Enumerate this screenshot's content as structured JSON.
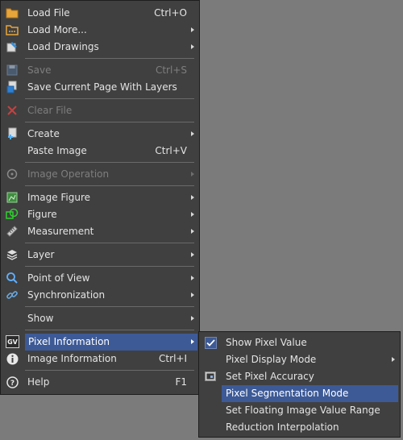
{
  "main_menu": {
    "items": [
      {
        "label": "Load File",
        "shortcut": "Ctrl+O"
      },
      {
        "label": "Load More..."
      },
      {
        "label": "Load Drawings"
      },
      {
        "label": "Save",
        "shortcut": "Ctrl+S"
      },
      {
        "label": "Save Current Page With Layers"
      },
      {
        "label": "Clear File"
      },
      {
        "label": "Create"
      },
      {
        "label": "Paste Image",
        "shortcut": "Ctrl+V"
      },
      {
        "label": "Image Operation"
      },
      {
        "label": "Image Figure"
      },
      {
        "label": "Figure"
      },
      {
        "label": "Measurement"
      },
      {
        "label": "Layer"
      },
      {
        "label": "Point of View"
      },
      {
        "label": "Synchronization"
      },
      {
        "label": "Show"
      },
      {
        "label": "Pixel Information"
      },
      {
        "label": "Image Information",
        "shortcut": "Ctrl+I"
      },
      {
        "label": "Help",
        "shortcut": "F1"
      }
    ],
    "pixel_info_icon_text": "GV"
  },
  "submenu": {
    "items": [
      {
        "label": "Show Pixel Value",
        "checked": true
      },
      {
        "label": "Pixel Display Mode"
      },
      {
        "label": "Set Pixel Accuracy"
      },
      {
        "label": "Pixel Segmentation Mode"
      },
      {
        "label": "Set Floating Image Value Range"
      },
      {
        "label": "Reduction Interpolation"
      }
    ]
  },
  "colors": {
    "menu_bg": "#404040",
    "highlight": "#3d5a96",
    "background": "#7b7b7b"
  }
}
